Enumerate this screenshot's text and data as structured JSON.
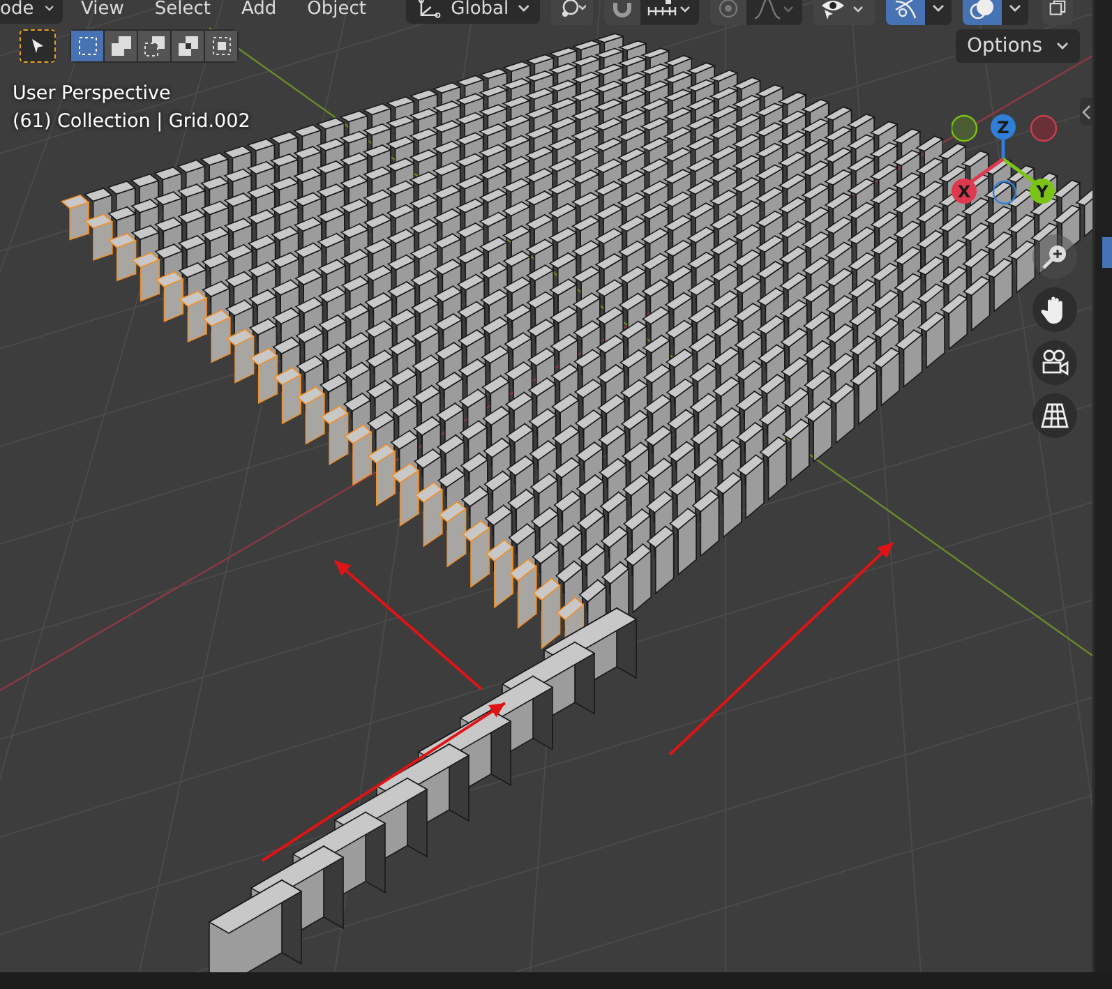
{
  "header": {
    "mode_dropdown": "ode",
    "menus": [
      "View",
      "Select",
      "Add",
      "Object"
    ],
    "orientation_dropdown": "Global"
  },
  "header_toggles": [
    {
      "kind": "pivot",
      "on": false
    },
    {
      "kind": "snap",
      "on": false
    },
    {
      "kind": "proportional",
      "on": false
    },
    {
      "kind": "visibility",
      "on": false
    },
    {
      "kind": "gizmo",
      "on": true
    },
    {
      "kind": "overlay",
      "on": true
    },
    {
      "kind": "xray",
      "on": false
    }
  ],
  "select_modes": [
    {
      "kind": "set",
      "selected": true
    },
    {
      "kind": "extend",
      "selected": false
    },
    {
      "kind": "subtract",
      "selected": false
    },
    {
      "kind": "invert",
      "selected": false
    },
    {
      "kind": "intersect",
      "selected": false
    }
  ],
  "options_dropdown": "Options",
  "viewport_info": {
    "view_name": "User Perspective",
    "collection": "(61) Collection | Grid.002"
  },
  "axis_gizmo": {
    "x": "X",
    "y": "Y",
    "z": "Z"
  }
}
